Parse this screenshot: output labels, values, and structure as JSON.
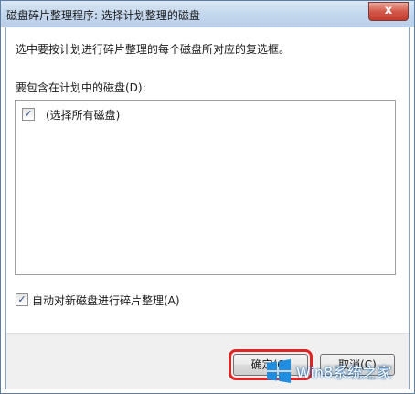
{
  "window": {
    "title": "磁盘碎片整理程序: 选择计划整理的磁盘",
    "close_label": "x"
  },
  "content": {
    "instruction": "选中要按计划进行碎片整理的每个磁盘所对应的复选框。",
    "list_label": "要包含在计划中的磁盘(D):",
    "list_items": [
      {
        "label": "(选择所有磁盘)",
        "checked": true
      }
    ],
    "auto_defrag_label": "自动对新磁盘进行碎片整理(A)",
    "auto_defrag_checked": true
  },
  "buttons": {
    "ok_label": "确定(O)",
    "cancel_label": "取消(C)"
  },
  "check_mark": "✓",
  "watermark": {
    "text": "Win8系统之家",
    "logo_icon": "windows-logo-icon"
  },
  "colors": {
    "highlight_box": "#e02424",
    "close_button": "#c23b2c"
  }
}
